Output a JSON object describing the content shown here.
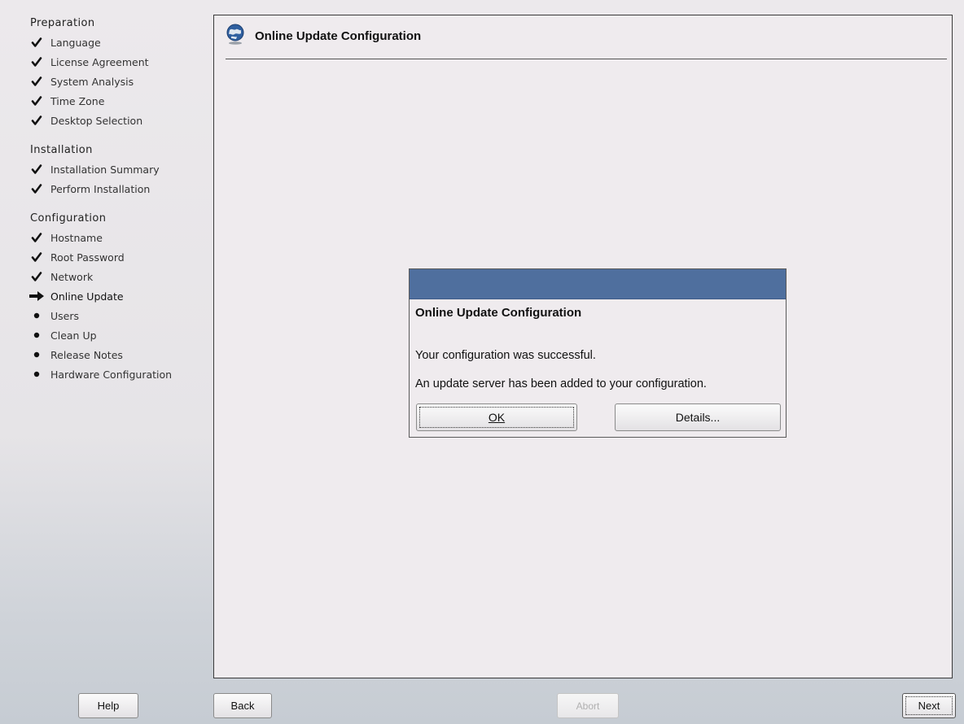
{
  "sidebar": {
    "sections": [
      {
        "title": "Preparation",
        "steps": [
          {
            "label": "Language",
            "status": "done"
          },
          {
            "label": "License Agreement",
            "status": "done"
          },
          {
            "label": "System Analysis",
            "status": "done"
          },
          {
            "label": "Time Zone",
            "status": "done"
          },
          {
            "label": "Desktop Selection",
            "status": "done"
          }
        ]
      },
      {
        "title": "Installation",
        "steps": [
          {
            "label": "Installation Summary",
            "status": "done"
          },
          {
            "label": "Perform Installation",
            "status": "done"
          }
        ]
      },
      {
        "title": "Configuration",
        "steps": [
          {
            "label": "Hostname",
            "status": "done"
          },
          {
            "label": "Root Password",
            "status": "done"
          },
          {
            "label": "Network",
            "status": "done"
          },
          {
            "label": "Online Update",
            "status": "current"
          },
          {
            "label": "Users",
            "status": "pending"
          },
          {
            "label": "Clean Up",
            "status": "pending"
          },
          {
            "label": "Release Notes",
            "status": "pending"
          },
          {
            "label": "Hardware Configuration",
            "status": "pending"
          }
        ]
      }
    ]
  },
  "main": {
    "title": "Online Update Configuration",
    "icon": "globe-icon"
  },
  "dialog": {
    "heading": "Online Update Configuration",
    "message1": "Your configuration was successful.",
    "message2": "An update server has been added to your configuration.",
    "ok_label": "OK",
    "details_label": "Details...",
    "titlebar_color": "#4f6f9e"
  },
  "footer": {
    "help_label": "Help",
    "back_label": "Back",
    "abort_label": "Abort",
    "next_label": "Next"
  },
  "colors": {
    "accent": "#4f6f9e",
    "panel_bg": "#efebee"
  }
}
